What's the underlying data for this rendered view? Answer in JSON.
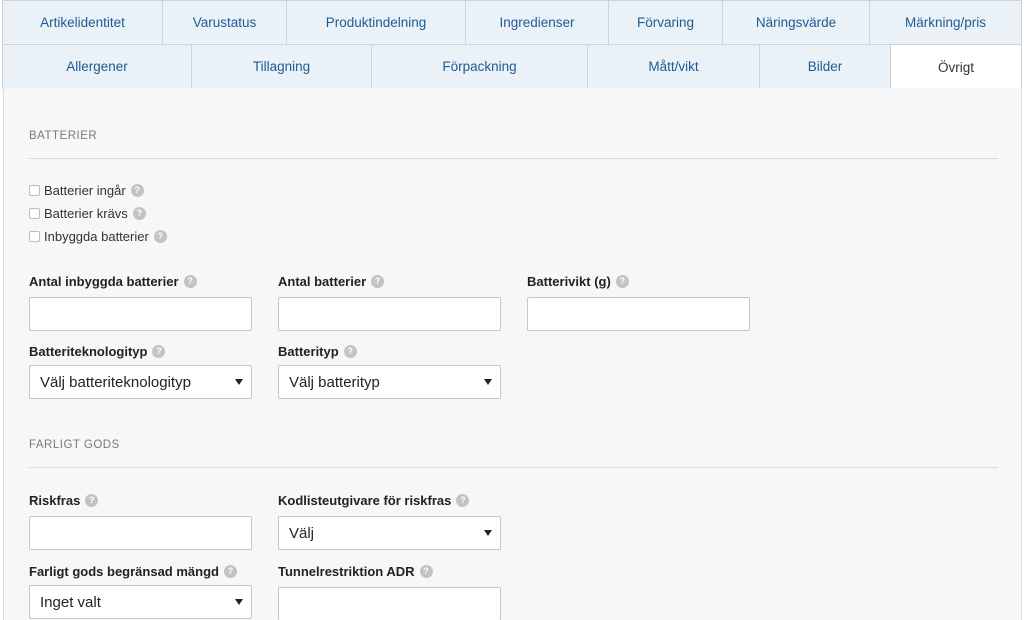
{
  "tabs": {
    "row1": [
      "Artikelidentitet",
      "Varustatus",
      "Produktindelning",
      "Ingredienser",
      "Förvaring",
      "Näringsvärde",
      "Märkning/pris"
    ],
    "row2": [
      "Allergener",
      "Tillagning",
      "Förpackning",
      "Mått/vikt",
      "Bilder",
      "Övrigt"
    ],
    "active": "Övrigt"
  },
  "batteries": {
    "section_title": "BATTERIER",
    "checkboxes": [
      "Batterier ingår",
      "Batterier krävs",
      "Inbyggda batterier"
    ],
    "built_in_count_label": "Antal inbyggda batterier",
    "battery_count_label": "Antal batterier",
    "battery_weight_label": "Batterivikt (g)",
    "technology_label": "Batteriteknologityp",
    "technology_value": "Välj batteriteknologityp",
    "type_label": "Batterityp",
    "type_value": "Välj batterityp"
  },
  "dangerous_goods": {
    "section_title": "FARLIGT GODS",
    "risk_phrase_label": "Riskfras",
    "code_provider_label": "Kodlisteutgivare för riskfras",
    "code_provider_value": "Välj",
    "limited_quantity_label": "Farligt gods begränsad mängd",
    "limited_quantity_value": "Inget valt",
    "tunnel_restriction_label": "Tunnelrestriktion ADR"
  },
  "icons": {
    "help": "question-circle-icon",
    "dropdown": "caret-down-icon"
  },
  "colors": {
    "tab_bg": "#eaf1f7",
    "tab_text": "#1e5b95",
    "panel_bg": "#f7f7f7"
  }
}
